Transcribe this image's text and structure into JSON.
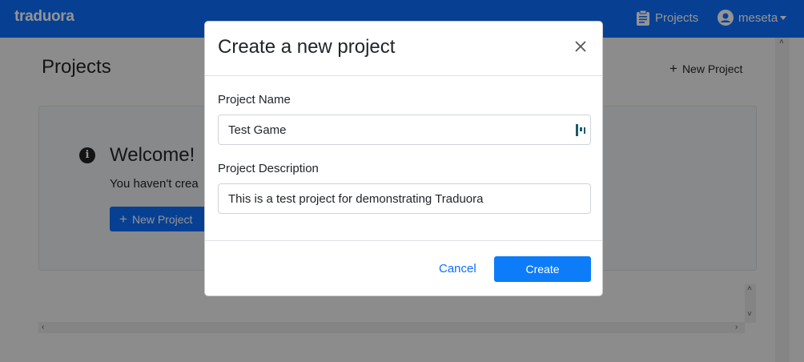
{
  "navbar": {
    "brand": "traduora",
    "projects_label": "Projects",
    "user_label": "meseta",
    "icons": [
      "clipboard-icon",
      "user-circle-icon",
      "caret-down-icon"
    ]
  },
  "page": {
    "title": "Projects",
    "new_project_label": "New Project",
    "welcome": {
      "title": "Welcome!",
      "text": "You haven't crea",
      "button_label": "New Project"
    }
  },
  "modal": {
    "title": "Create a new project",
    "name_label": "Project Name",
    "name_value": "Test Game",
    "description_label": "Project Description",
    "description_value": "This is a test project for demonstrating Traduora",
    "cancel_label": "Cancel",
    "create_label": "Create"
  },
  "colors": {
    "primary": "#0d6efd",
    "overlay": "rgba(0,0,0,0.42)"
  }
}
